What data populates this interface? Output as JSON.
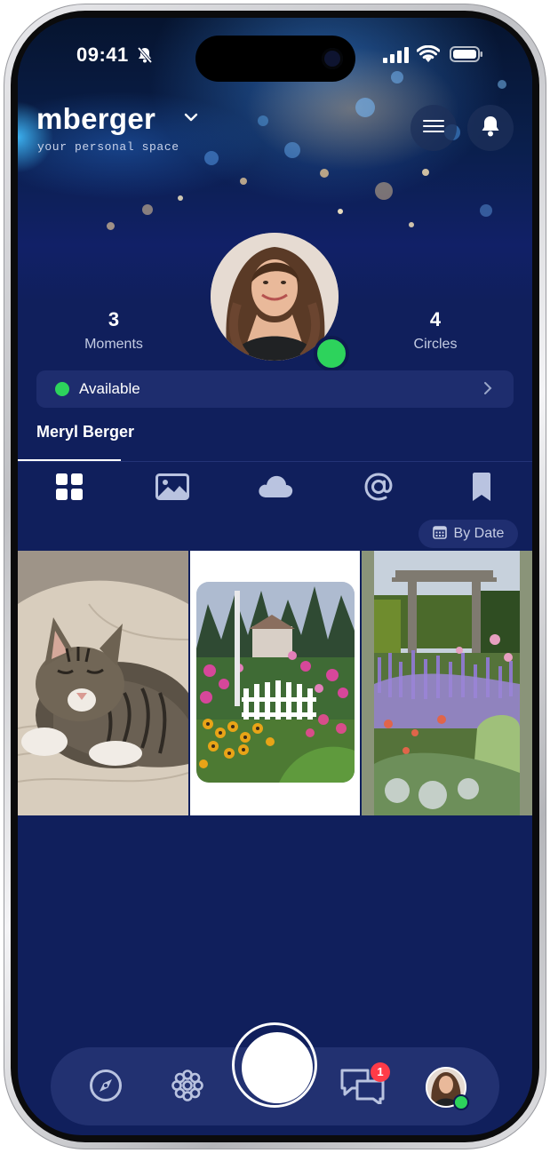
{
  "status_bar": {
    "time": "09:41"
  },
  "header": {
    "username": "mberger",
    "tagline": "your personal space"
  },
  "profile": {
    "name": "Meryl Berger",
    "stats": [
      {
        "value": "3",
        "label": "Moments"
      },
      {
        "value": "4",
        "label": "Circles"
      }
    ],
    "status": "Available"
  },
  "tabs": [
    {
      "name": "grid",
      "icon": "grid-icon",
      "active": true
    },
    {
      "name": "photos",
      "icon": "image-icon",
      "active": false
    },
    {
      "name": "cloud",
      "icon": "cloud-icon",
      "active": false
    },
    {
      "name": "mentions",
      "icon": "at-icon",
      "active": false
    },
    {
      "name": "saved",
      "icon": "bookmark-icon",
      "active": false
    }
  ],
  "sort": {
    "label": "By Date",
    "icon": "calendar-icon"
  },
  "moments": [
    {
      "subject": "sleeping tabby cat"
    },
    {
      "subject": "flower garden with white picket fence"
    },
    {
      "subject": "lavender garden with wooden arbor"
    }
  ],
  "bottom_nav": {
    "items": [
      "compass-icon",
      "flower-icon",
      "capture-button",
      "chat-icon",
      "profile-avatar"
    ],
    "chat_badge": "1"
  },
  "colors": {
    "background": "#101f5c",
    "online": "#2dd35c",
    "badge": "#ff3b48"
  }
}
